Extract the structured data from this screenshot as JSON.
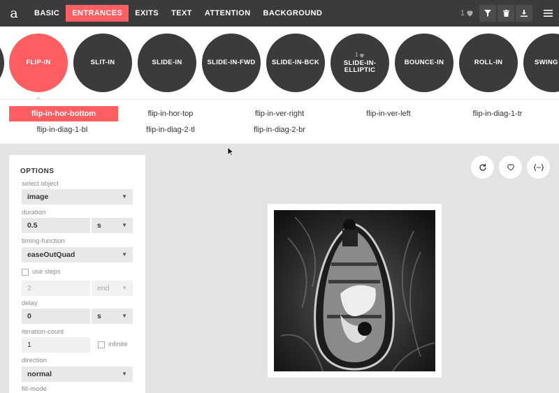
{
  "brand": {
    "logo": "a"
  },
  "nav": [
    {
      "label": "BASIC",
      "active": false
    },
    {
      "label": "ENTRANCES",
      "active": true
    },
    {
      "label": "EXITS",
      "active": false
    },
    {
      "label": "TEXT",
      "active": false
    },
    {
      "label": "ATTENTION",
      "active": false
    },
    {
      "label": "BACKGROUND",
      "active": false
    }
  ],
  "topright": {
    "favorites_count": "1"
  },
  "icons": {
    "heart": "heart-icon",
    "filter": "filter-icon",
    "trash": "trash-icon",
    "download": "download-icon",
    "menu": "hamburger-menu-icon",
    "replay": "replay-icon",
    "code": "code-icon"
  },
  "animations": [
    {
      "label": "",
      "active": false
    },
    {
      "label": "FLIP-IN",
      "active": true
    },
    {
      "label": "SLIT-IN",
      "active": false
    },
    {
      "label": "SLIDE-IN",
      "active": false
    },
    {
      "label": "SLIDE-IN-FWD",
      "active": false
    },
    {
      "label": "SLIDE-IN-BCK",
      "active": false
    },
    {
      "label": "SLIDE-IN-ELLIPTIC",
      "line1": "SLIDE-IN-",
      "line2": "ELLIPTIC",
      "fav_count": "1",
      "active": false
    },
    {
      "label": "BOUNCE-IN",
      "active": false
    },
    {
      "label": "ROLL-IN",
      "active": false
    },
    {
      "label": "SWING",
      "active": false
    }
  ],
  "variants": [
    {
      "label": "flip-in-hor-bottom",
      "active": true
    },
    {
      "label": "flip-in-hor-top",
      "active": false
    },
    {
      "label": "flip-in-ver-right",
      "active": false
    },
    {
      "label": "flip-in-ver-left",
      "active": false
    },
    {
      "label": "flip-in-diag-1-tr",
      "active": false
    },
    {
      "label": "flip-in-diag-1-bl",
      "active": false
    },
    {
      "label": "flip-in-diag-2-tl",
      "active": false
    },
    {
      "label": "flip-in-diag-2-br",
      "active": false
    }
  ],
  "options": {
    "title": "OPTIONS",
    "select_object": {
      "label": "select object",
      "value": "image"
    },
    "duration": {
      "label": "duration",
      "value": "0.5",
      "unit": "s"
    },
    "timing_function": {
      "label": "timing-function",
      "value": "easeOutQuad"
    },
    "use_steps": {
      "label": "use steps",
      "checked": false,
      "steps_value": "2",
      "steps_mode": "end"
    },
    "delay": {
      "label": "delay",
      "value": "0",
      "unit": "s"
    },
    "iteration_count": {
      "label": "iteration-count",
      "value": "1",
      "infinite_label": "infinite",
      "infinite_checked": false
    },
    "direction": {
      "label": "direction",
      "value": "normal"
    },
    "fill_mode": {
      "label": "fill-mode"
    }
  },
  "colors": {
    "accent": "#ff5e62",
    "dark": "#3b3b3b",
    "background": "#e3e3e3"
  }
}
